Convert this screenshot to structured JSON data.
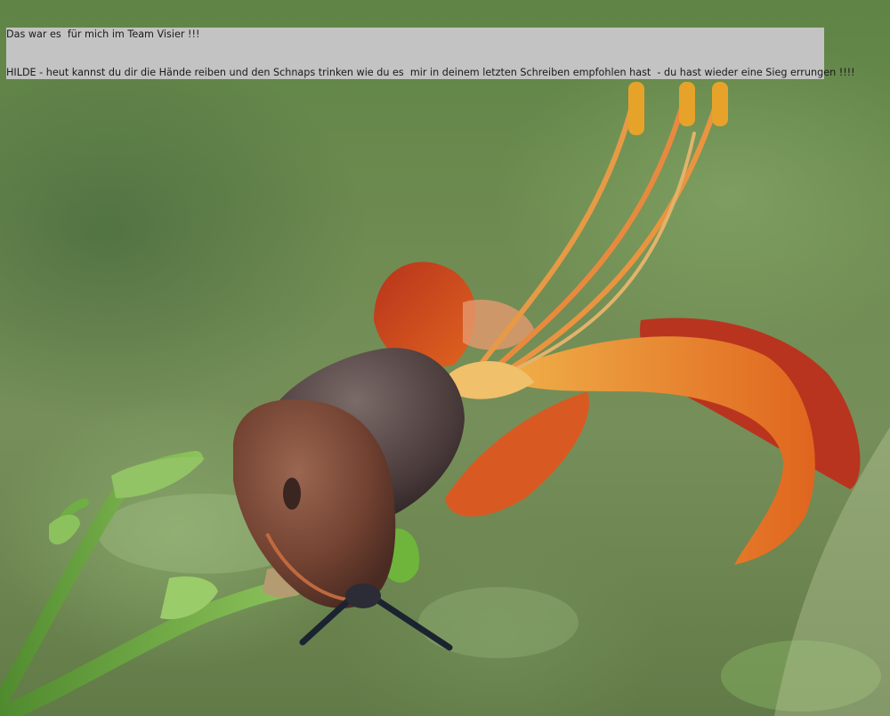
{
  "caption": {
    "line1": "Das war es  für mich im Team Visier !!!",
    "line2": "HILDE - heut kannst du dir die Hände reiben und den Schnaps trinken wie du es  mir in deinem letzten Schreiben empfohlen hast  - du hast wieder eine Sieg errungen !!!!"
  },
  "photo": {
    "subject": "slug-on-lily",
    "colors": {
      "background": "#6f8c52",
      "slug_body": "#7a4a35",
      "slug_tentacles": "#1b2330",
      "petal": "#c9431f",
      "petal_orange": "#e07a22",
      "stamen": "#e4a23c",
      "stem": "#5f9a3a",
      "caption_bg": "#c3c3c3"
    }
  }
}
